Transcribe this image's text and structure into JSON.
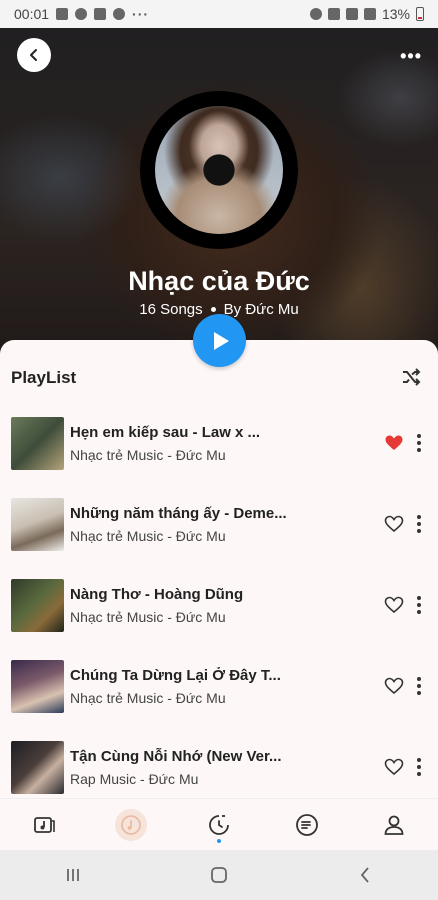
{
  "status_bar": {
    "time": "00:01",
    "battery": "13%"
  },
  "header": {
    "more_label": "•••"
  },
  "playlist": {
    "title": "Nhạc của Đức",
    "song_count": "16 Songs",
    "author": "By Đức Mu"
  },
  "section_title": "PlayList",
  "colors": {
    "accent": "#2196f3",
    "liked": "#e53935"
  },
  "songs": [
    {
      "title": "Hẹn em kiếp sau -  Law x ...",
      "subtitle": "Nhạc trẻ Music - Đức Mu",
      "liked": true
    },
    {
      "title": "Những năm tháng ấy - Deme...",
      "subtitle": "Nhạc trẻ Music - Đức Mu",
      "liked": false
    },
    {
      "title": "Nàng Thơ - Hoàng Dũng",
      "subtitle": "Nhạc trẻ Music - Đức Mu",
      "liked": false
    },
    {
      "title": "Chúng Ta Dừng Lại Ở Đây T...",
      "subtitle": "Nhạc trẻ Music - Đức Mu",
      "liked": false
    },
    {
      "title": "Tận Cùng Nỗi Nhớ (New Ver...",
      "subtitle": "Rap Music - Đức Mu",
      "liked": false
    }
  ],
  "bottom_nav": [
    "music-library-icon",
    "now-playing-icon",
    "history-icon",
    "playlist-icon",
    "profile-icon"
  ],
  "system_nav": [
    "recent-apps-icon",
    "home-icon",
    "back-icon"
  ]
}
